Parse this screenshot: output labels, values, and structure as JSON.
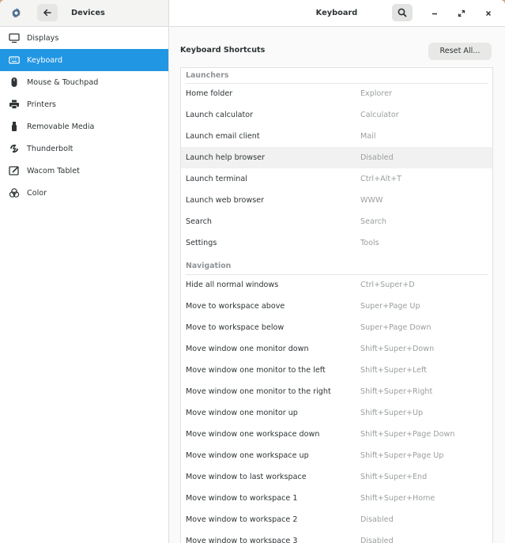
{
  "header": {
    "section_title": "Devices",
    "page_title": "Keyboard",
    "icons": {
      "settings": "gear-icon",
      "back": "arrow-left-icon",
      "search": "search-icon",
      "minimize": "minimize-icon",
      "maximize": "maximize-icon",
      "close": "close-icon"
    }
  },
  "sidebar": {
    "items": [
      {
        "label": "Displays",
        "icon": "display-icon"
      },
      {
        "label": "Keyboard",
        "icon": "keyboard-icon",
        "active": true
      },
      {
        "label": "Mouse & Touchpad",
        "icon": "mouse-icon"
      },
      {
        "label": "Printers",
        "icon": "printer-icon"
      },
      {
        "label": "Removable Media",
        "icon": "usb-icon"
      },
      {
        "label": "Thunderbolt",
        "icon": "thunderbolt-icon"
      },
      {
        "label": "Wacom Tablet",
        "icon": "tablet-icon"
      },
      {
        "label": "Color",
        "icon": "color-icon"
      }
    ]
  },
  "main": {
    "title": "Keyboard Shortcuts",
    "reset_label": "Reset All...",
    "sections": [
      {
        "title": "Launchers",
        "rows": [
          {
            "name": "Home folder",
            "accel": "Explorer"
          },
          {
            "name": "Launch calculator",
            "accel": "Calculator"
          },
          {
            "name": "Launch email client",
            "accel": "Mail"
          },
          {
            "name": "Launch help browser",
            "accel": "Disabled",
            "highlighted": true
          },
          {
            "name": "Launch terminal",
            "accel": "Ctrl+Alt+T"
          },
          {
            "name": "Launch web browser",
            "accel": "WWW"
          },
          {
            "name": "Search",
            "accel": "Search"
          },
          {
            "name": "Settings",
            "accel": "Tools"
          }
        ]
      },
      {
        "title": "Navigation",
        "rows": [
          {
            "name": "Hide all normal windows",
            "accel": "Ctrl+Super+D"
          },
          {
            "name": "Move to workspace above",
            "accel": "Super+Page Up"
          },
          {
            "name": "Move to workspace below",
            "accel": "Super+Page Down"
          },
          {
            "name": "Move window one monitor down",
            "accel": "Shift+Super+Down"
          },
          {
            "name": "Move window one monitor to the left",
            "accel": "Shift+Super+Left"
          },
          {
            "name": "Move window one monitor to the right",
            "accel": "Shift+Super+Right"
          },
          {
            "name": "Move window one monitor up",
            "accel": "Shift+Super+Up"
          },
          {
            "name": "Move window one workspace down",
            "accel": "Shift+Super+Page Down"
          },
          {
            "name": "Move window one workspace up",
            "accel": "Shift+Super+Page Up"
          },
          {
            "name": "Move window to last workspace",
            "accel": "Shift+Super+End"
          },
          {
            "name": "Move window to workspace 1",
            "accel": "Shift+Super+Home"
          },
          {
            "name": "Move window to workspace 2",
            "accel": "Disabled"
          },
          {
            "name": "Move window to workspace 3",
            "accel": "Disabled"
          }
        ]
      }
    ]
  },
  "colors": {
    "accent": "#2196e3",
    "background": "#d7a27e"
  }
}
